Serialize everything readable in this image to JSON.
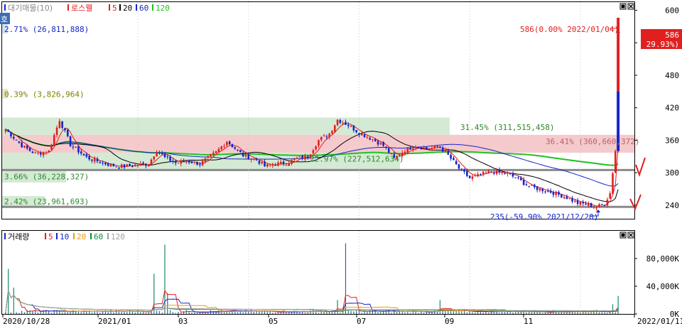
{
  "legend_price": {
    "title": "대기매물(10)",
    "stock": "로스웰",
    "ma": [
      {
        "label": "5",
        "color": "#e0201f"
      },
      {
        "label": "20",
        "color": "#000000"
      },
      {
        "label": "60",
        "color": "#1525c8"
      },
      {
        "label": "120",
        "color": "#22c022"
      }
    ]
  },
  "legend_volume": {
    "title": "거래량",
    "ma": [
      {
        "label": "5",
        "color": "#e0201f"
      },
      {
        "label": "10",
        "color": "#1525c8"
      },
      {
        "label": "20",
        "color": "#e89b10"
      },
      {
        "label": "60",
        "color": "#0a8a3a"
      },
      {
        "label": "120",
        "color": "#a0a0a0"
      }
    ]
  },
  "corner_tab": "호",
  "supply_labels": [
    {
      "text": "2.71% (26,811,888)",
      "price": 565
    },
    {
      "text": "0.39% (3,826,964)",
      "price": 445
    },
    {
      "text": "31.45% (311,515,458)",
      "price": 384
    },
    {
      "text": "36.41% (360,660,372)",
      "price": 358
    },
    {
      "text": "22.97% (227,512,634)",
      "price": 326
    },
    {
      "text": "3.66% (36,228,327)",
      "price": 293
    },
    {
      "text": "2.42% (23,961,693)",
      "price": 247
    }
  ],
  "high_label": "586(0.00% 2022/01/04)",
  "low_label": "235(-59.90% 2021/12/20)",
  "current_price": {
    "value": "586",
    "change": "( 29.93%)"
  },
  "chart_data": {
    "type": "candlestick",
    "price_axis": {
      "min": 215,
      "max": 615,
      "ticks": [
        240,
        300,
        360,
        420,
        480,
        540,
        600
      ]
    },
    "volume_axis": {
      "max": 120000,
      "ticks": [
        {
          "v": 0,
          "label": "0K"
        },
        {
          "v": 40000,
          "label": "40,000K"
        },
        {
          "v": 80000,
          "label": "80,000K"
        }
      ]
    },
    "x_labels": [
      "2020/10/28",
      "2021/01",
      "03",
      "05",
      "07",
      "09",
      "11",
      "2022/01/11"
    ],
    "supply_zones": [
      {
        "percent": 2.71,
        "volume": 26811888,
        "from": 557,
        "to": 575
      },
      {
        "percent": 0.39,
        "volume": 3826964,
        "from": 437,
        "to": 455
      },
      {
        "percent": 31.45,
        "volume": 311515458,
        "from": 370,
        "to": 402
      },
      {
        "percent": 36.41,
        "volume": 360660372,
        "from": 337,
        "to": 370
      },
      {
        "percent": 22.97,
        "volume": 227512634,
        "from": 305,
        "to": 337
      },
      {
        "percent": 3.66,
        "volume": 36228327,
        "from": 282,
        "to": 305
      },
      {
        "percent": 2.42,
        "volume": 23961693,
        "from": 237,
        "to": 257
      }
    ],
    "support_lines": [
      305,
      237
    ],
    "highest": {
      "price": 586,
      "change_pct": 0.0,
      "date": "2022/01/04"
    },
    "lowest": {
      "price": 235,
      "change_pct": -59.9,
      "date": "2021/12/20"
    },
    "last": {
      "price": 586,
      "change_pct": 29.93
    },
    "price_keypoints": [
      [
        0,
        380
      ],
      [
        6,
        350
      ],
      [
        11,
        335
      ],
      [
        16,
        340
      ],
      [
        20,
        398
      ],
      [
        24,
        352
      ],
      [
        30,
        328
      ],
      [
        36,
        318
      ],
      [
        42,
        311
      ],
      [
        48,
        314
      ],
      [
        53,
        316
      ],
      [
        56,
        342
      ],
      [
        59,
        328
      ],
      [
        63,
        318
      ],
      [
        67,
        322
      ],
      [
        72,
        316
      ],
      [
        78,
        338
      ],
      [
        82,
        358
      ],
      [
        88,
        332
      ],
      [
        93,
        324
      ],
      [
        96,
        312
      ],
      [
        100,
        316
      ],
      [
        104,
        318
      ],
      [
        108,
        326
      ],
      [
        112,
        330
      ],
      [
        116,
        360
      ],
      [
        120,
        372
      ],
      [
        123,
        398
      ],
      [
        127,
        388
      ],
      [
        131,
        374
      ],
      [
        136,
        362
      ],
      [
        140,
        350
      ],
      [
        144,
        326
      ],
      [
        148,
        342
      ],
      [
        152,
        350
      ],
      [
        156,
        344
      ],
      [
        161,
        348
      ],
      [
        164,
        332
      ],
      [
        168,
        308
      ],
      [
        172,
        290
      ],
      [
        176,
        296
      ],
      [
        180,
        302
      ],
      [
        186,
        298
      ],
      [
        190,
        288
      ],
      [
        194,
        274
      ],
      [
        198,
        270
      ],
      [
        203,
        263
      ],
      [
        208,
        254
      ],
      [
        212,
        244
      ],
      [
        216,
        241
      ],
      [
        219,
        236
      ],
      [
        222,
        244
      ],
      [
        224,
        262
      ],
      [
        226,
        340
      ],
      [
        227,
        586
      ]
    ],
    "volume_spikes": [
      {
        "i": 1,
        "v": 65000
      },
      {
        "i": 3,
        "v": 38000
      },
      {
        "i": 55,
        "v": 58000
      },
      {
        "i": 59,
        "v": 100000
      },
      {
        "i": 60,
        "v": 30000
      },
      {
        "i": 123,
        "v": 20000
      },
      {
        "i": 126,
        "v": 102000
      },
      {
        "i": 161,
        "v": 20000
      },
      {
        "i": 225,
        "v": 14000
      },
      {
        "i": 227,
        "v": 26000
      }
    ]
  }
}
